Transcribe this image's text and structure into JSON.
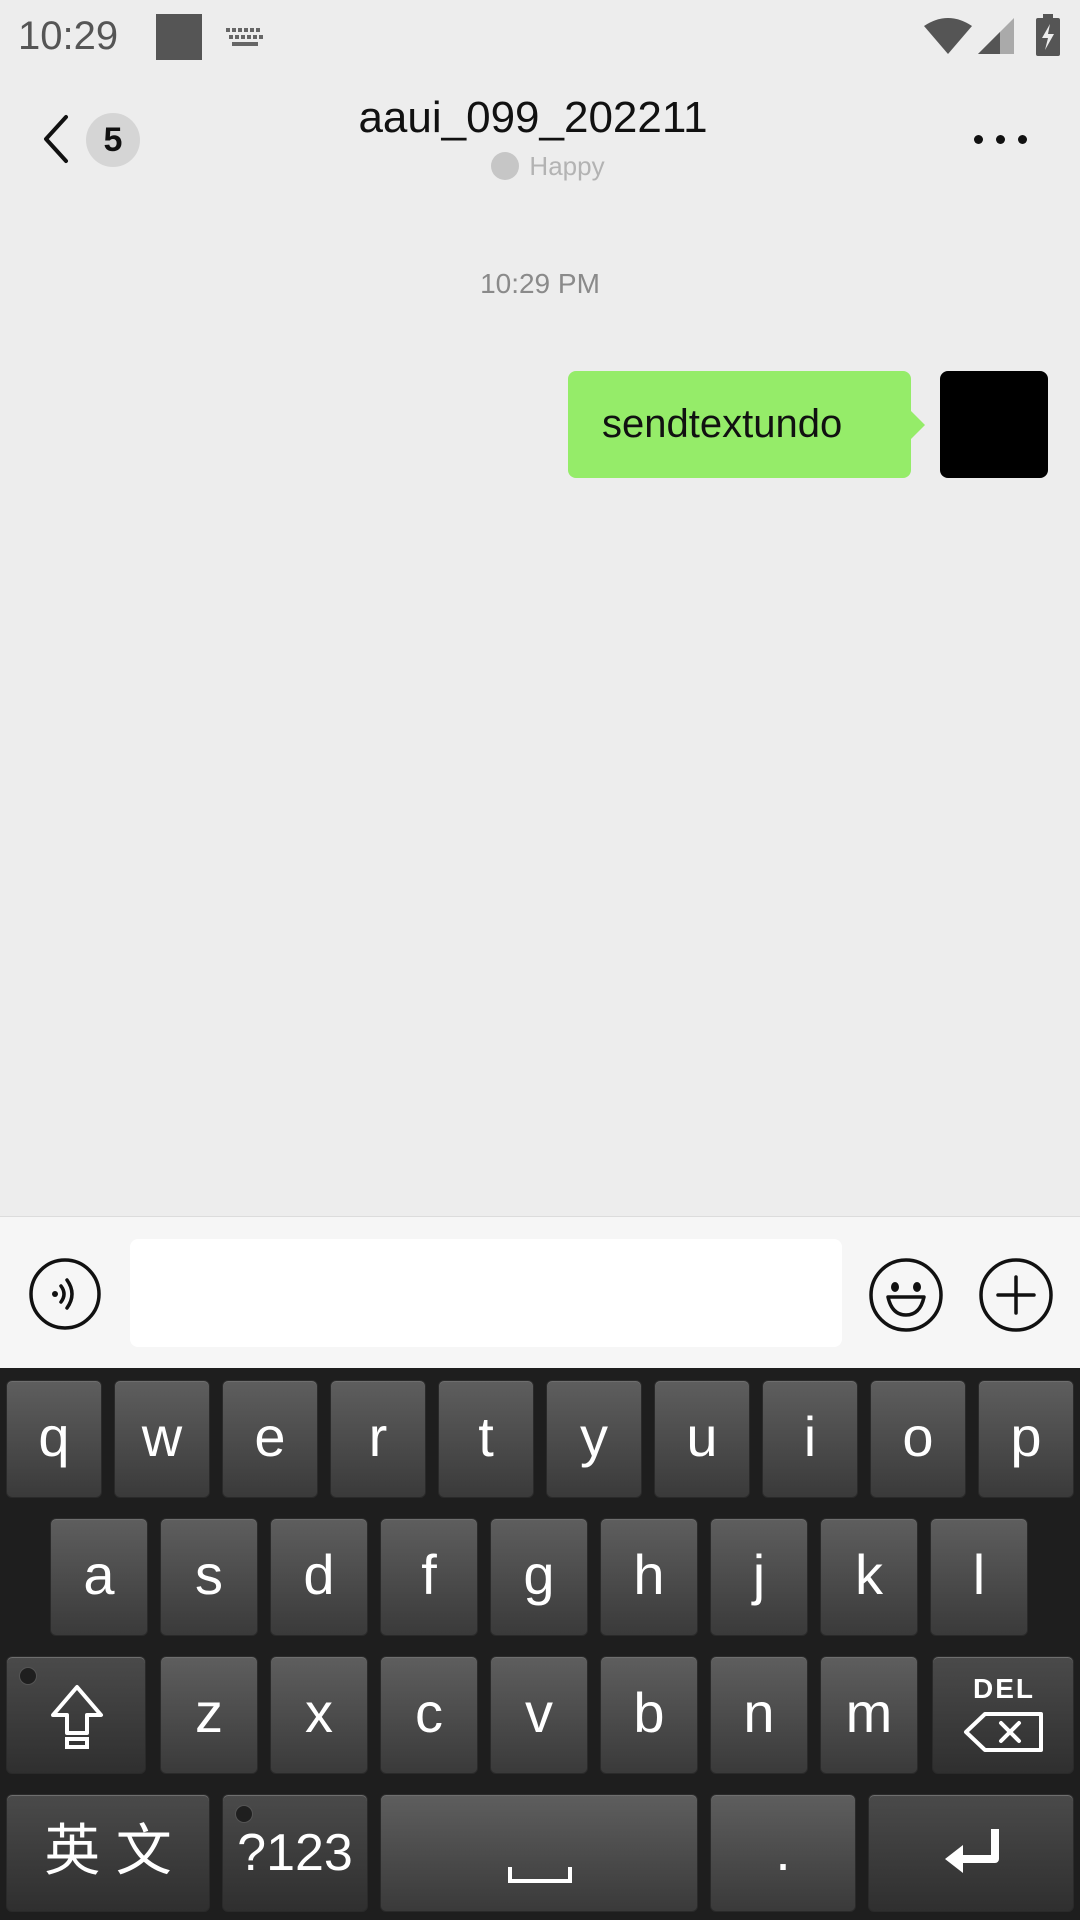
{
  "status_bar": {
    "time": "10:29"
  },
  "header": {
    "unread_count": "5",
    "title": "aaui_099_202211",
    "status": "Happy"
  },
  "chat": {
    "timestamp": "10:29 PM",
    "messages": [
      {
        "text": "sendtextundo",
        "sender": "me"
      }
    ]
  },
  "input_bar": {
    "value": ""
  },
  "keyboard": {
    "row1": [
      "q",
      "w",
      "e",
      "r",
      "t",
      "y",
      "u",
      "i",
      "o",
      "p"
    ],
    "row2": [
      "a",
      "s",
      "d",
      "f",
      "g",
      "h",
      "j",
      "k",
      "l"
    ],
    "row3": [
      "z",
      "x",
      "c",
      "v",
      "b",
      "n",
      "m"
    ],
    "del_label": "DEL",
    "lang_label": "英 文",
    "sym_label": "?123",
    "period_label": "."
  },
  "colors": {
    "bubble": "#95ec69",
    "background": "#ededed"
  }
}
